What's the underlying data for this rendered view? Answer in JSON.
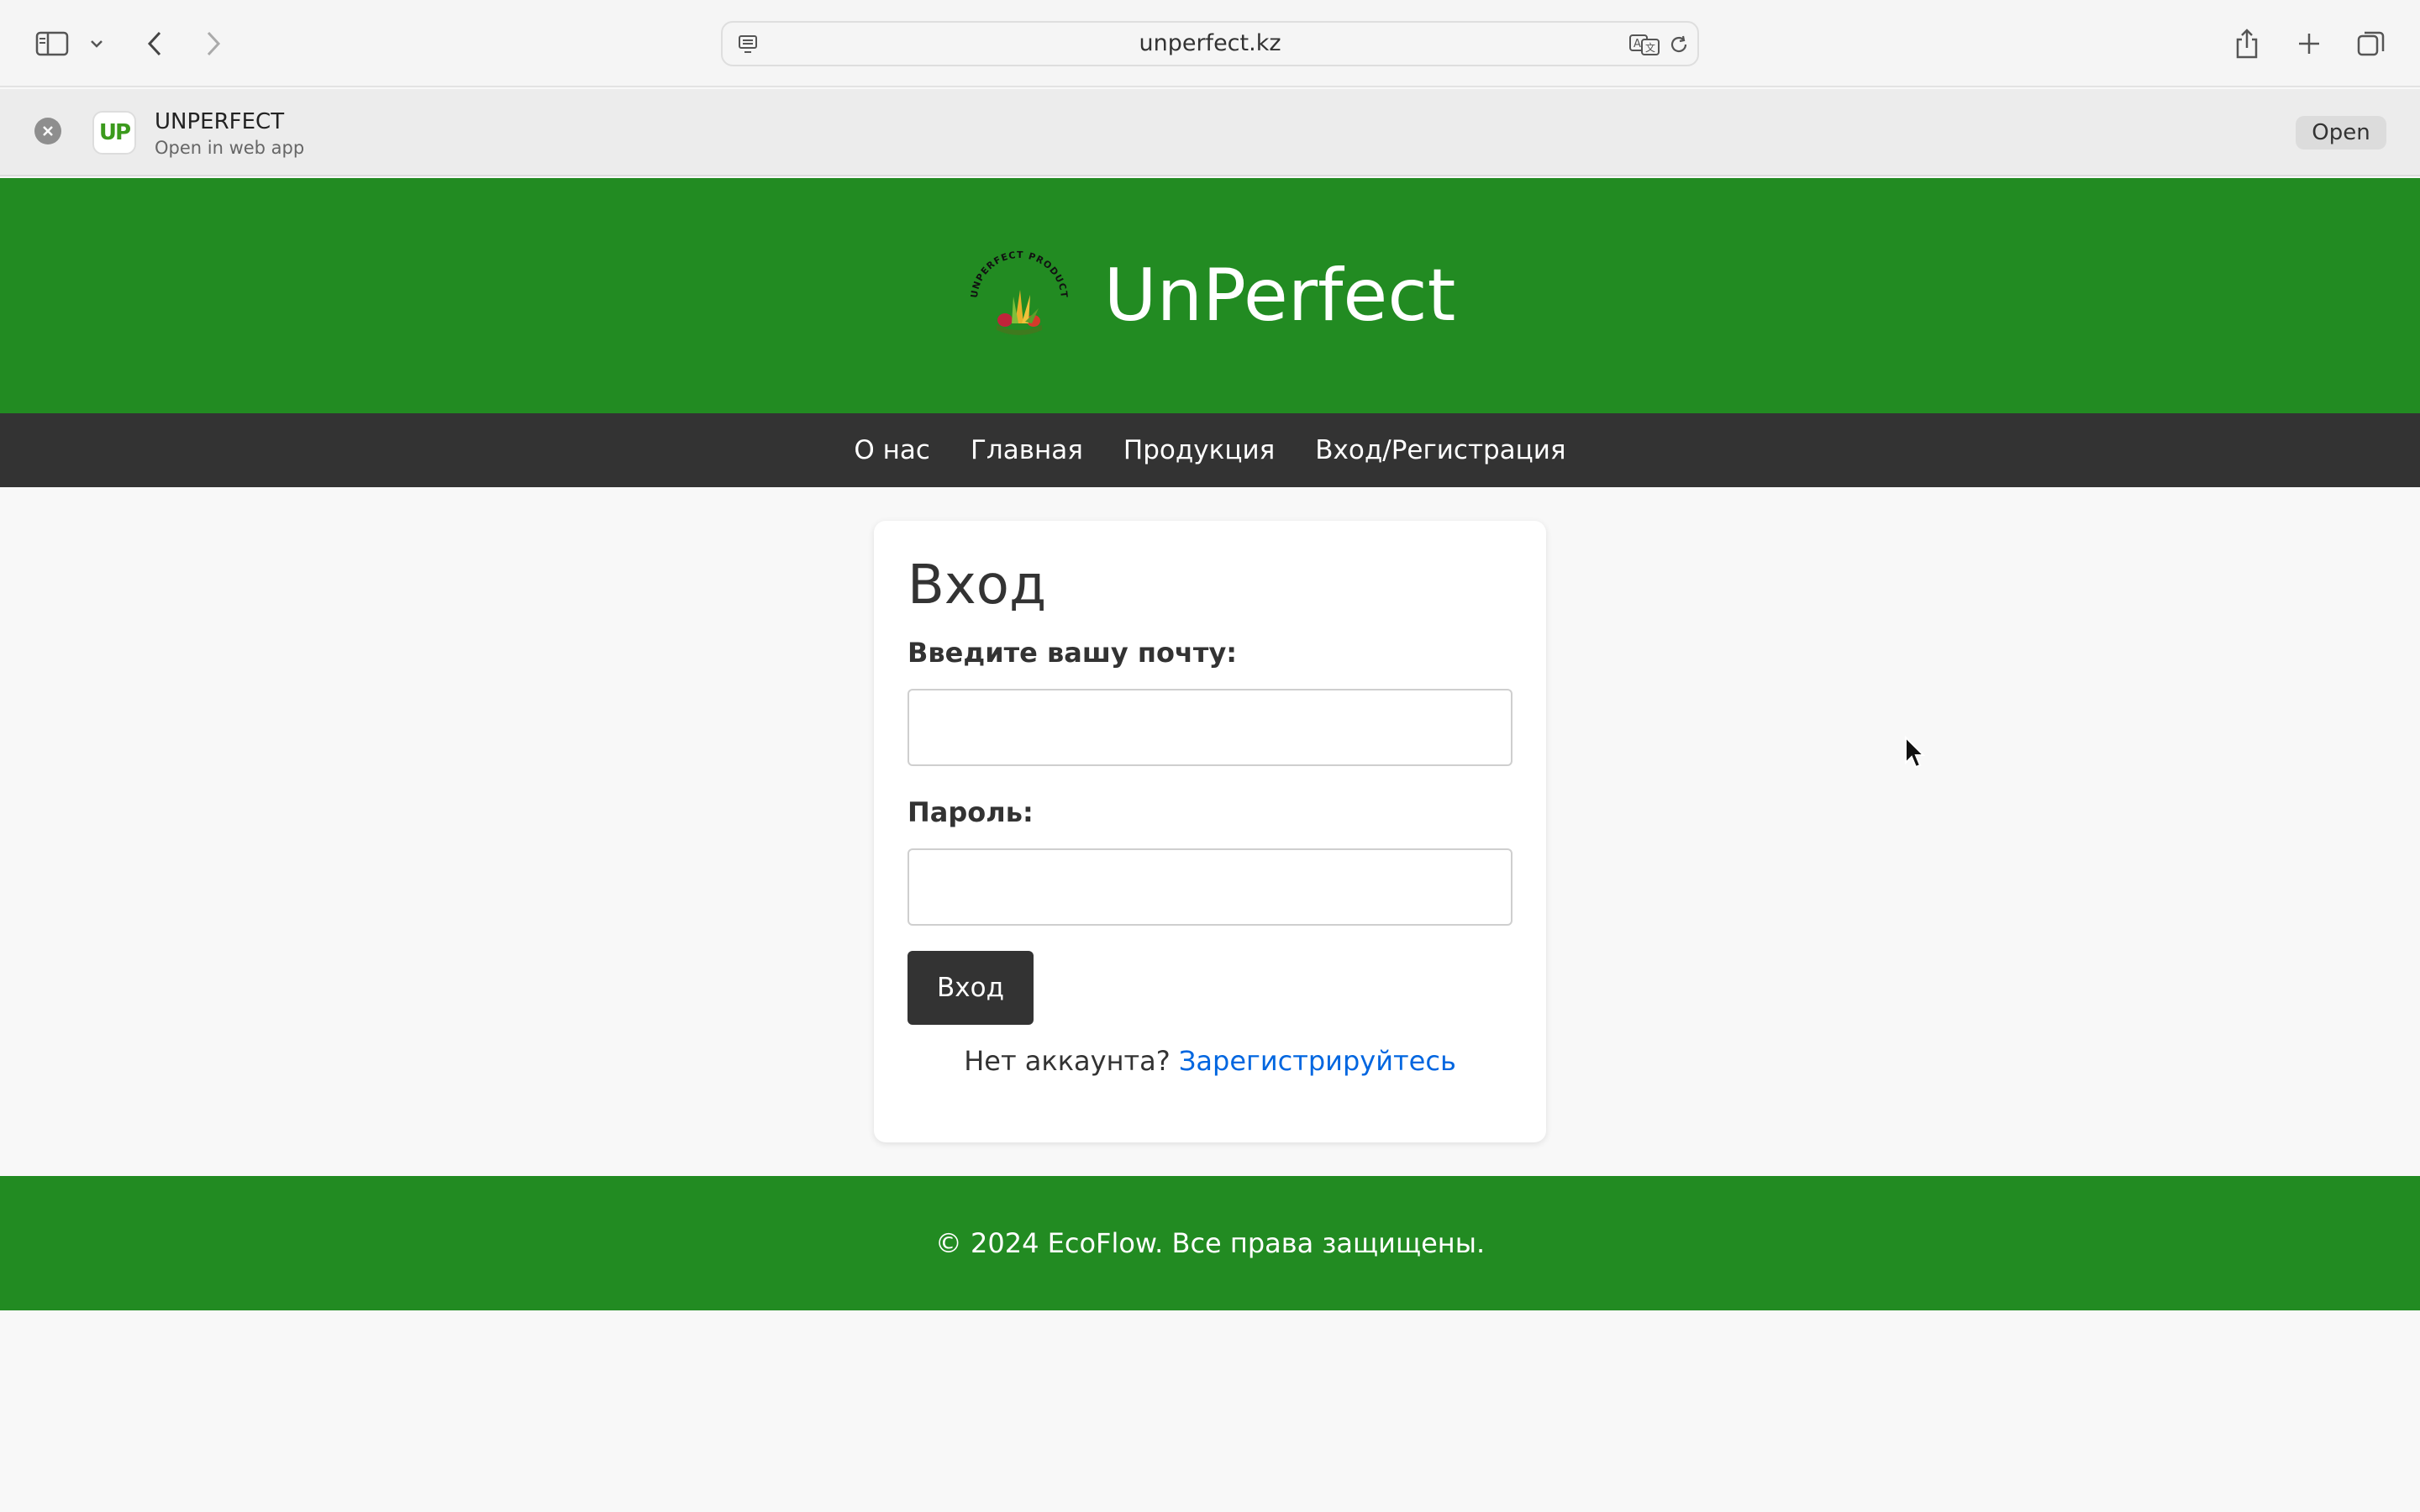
{
  "browser": {
    "url": "unperfect.kz"
  },
  "banner": {
    "app_icon_text": "UP",
    "app_name": "UNPERFECT",
    "subtitle": "Open in web app",
    "open_label": "Open"
  },
  "site": {
    "brand": "UnPerfect",
    "logo_text": "UNPERFECT PRODUCTS",
    "colors": {
      "header": "#228b22",
      "nav": "#333333",
      "link": "#0066e0"
    }
  },
  "nav": {
    "items": [
      "О нас",
      "Главная",
      "Продукция",
      "Вход/Регистрация"
    ]
  },
  "login": {
    "title": "Вход",
    "email_label": "Введите вашу почту:",
    "email_value": "",
    "password_label": "Пароль:",
    "password_value": "",
    "submit_label": "Вход",
    "register_prompt": "Нет аккаунта?",
    "register_link": "Зарегистрируйтесь"
  },
  "footer": {
    "text": "© 2024 EcoFlow. Все права защищены."
  }
}
